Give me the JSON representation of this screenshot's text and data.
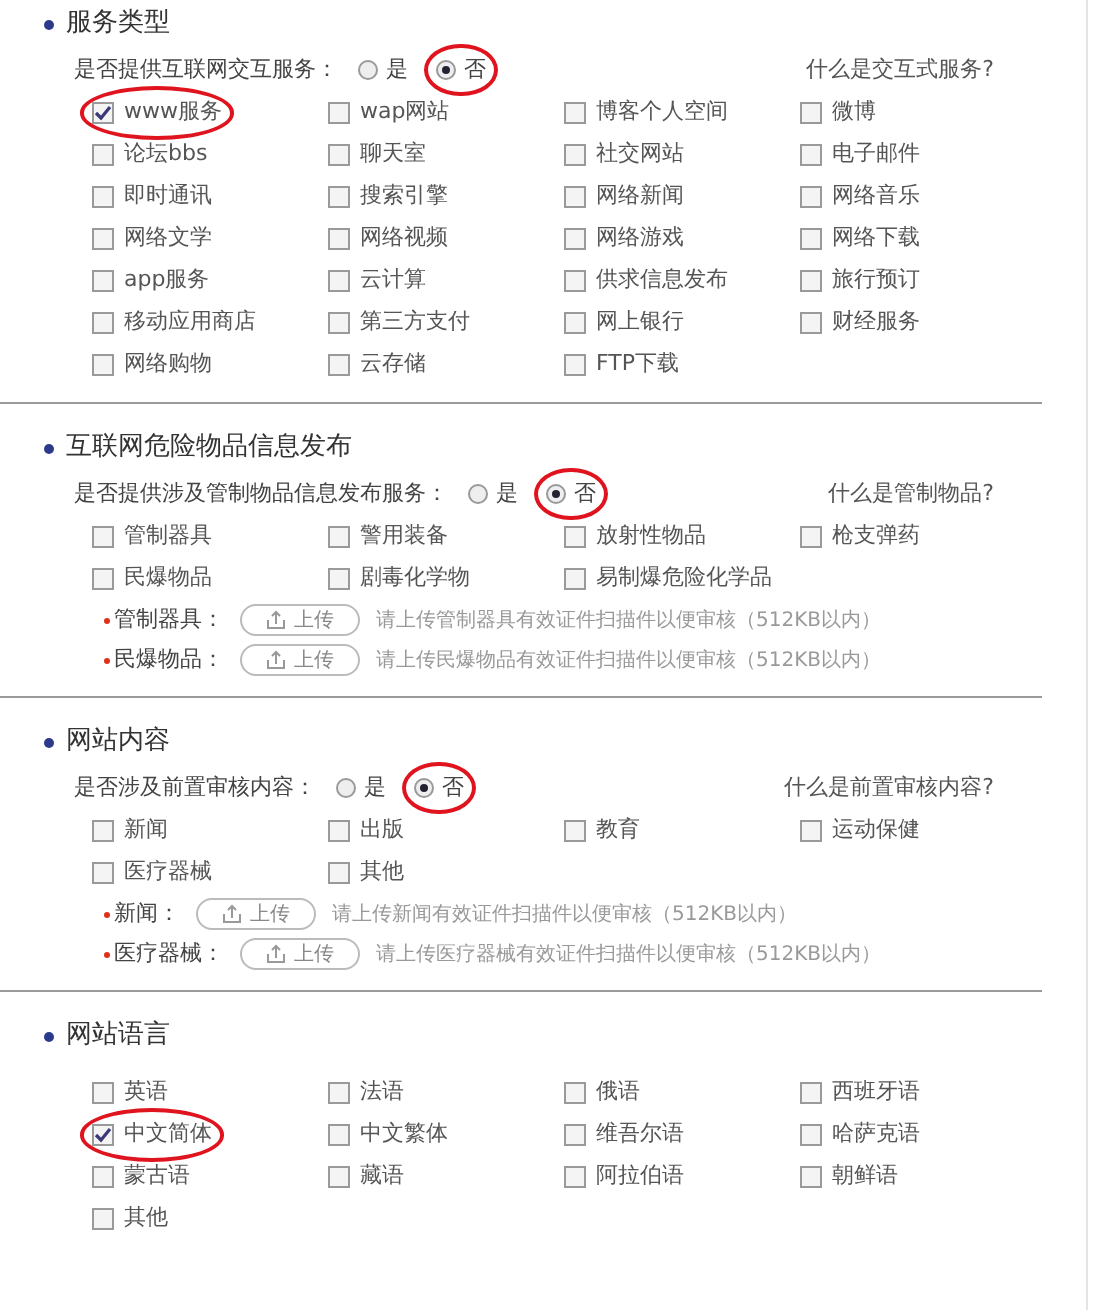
{
  "sections": [
    {
      "title": "服务类型",
      "question": {
        "label": "是否提供互联网交互服务：",
        "options": [
          {
            "label": "是",
            "selected": false,
            "circled": false
          },
          {
            "label": "否",
            "selected": true,
            "circled": true
          }
        ],
        "help_link": "什么是交互式服务?"
      },
      "items": [
        {
          "label": "www服务",
          "checked": true,
          "circled": true
        },
        {
          "label": "wap网站",
          "checked": false,
          "circled": false
        },
        {
          "label": "博客个人空间",
          "checked": false,
          "circled": false
        },
        {
          "label": "微博",
          "checked": false,
          "circled": false
        },
        {
          "label": "论坛bbs",
          "checked": false,
          "circled": false
        },
        {
          "label": "聊天室",
          "checked": false,
          "circled": false
        },
        {
          "label": "社交网站",
          "checked": false,
          "circled": false
        },
        {
          "label": "电子邮件",
          "checked": false,
          "circled": false
        },
        {
          "label": "即时通讯",
          "checked": false,
          "circled": false
        },
        {
          "label": "搜索引擎",
          "checked": false,
          "circled": false
        },
        {
          "label": "网络新闻",
          "checked": false,
          "circled": false
        },
        {
          "label": "网络音乐",
          "checked": false,
          "circled": false
        },
        {
          "label": "网络文学",
          "checked": false,
          "circled": false
        },
        {
          "label": "网络视频",
          "checked": false,
          "circled": false
        },
        {
          "label": "网络游戏",
          "checked": false,
          "circled": false
        },
        {
          "label": "网络下载",
          "checked": false,
          "circled": false
        },
        {
          "label": "app服务",
          "checked": false,
          "circled": false
        },
        {
          "label": "云计算",
          "checked": false,
          "circled": false
        },
        {
          "label": "供求信息发布",
          "checked": false,
          "circled": false
        },
        {
          "label": "旅行预订",
          "checked": false,
          "circled": false
        },
        {
          "label": "移动应用商店",
          "checked": false,
          "circled": false
        },
        {
          "label": "第三方支付",
          "checked": false,
          "circled": false
        },
        {
          "label": "网上银行",
          "checked": false,
          "circled": false
        },
        {
          "label": "财经服务",
          "checked": false,
          "circled": false
        },
        {
          "label": "网络购物",
          "checked": false,
          "circled": false
        },
        {
          "label": "云存储",
          "checked": false,
          "circled": false
        },
        {
          "label": "FTP下载",
          "checked": false,
          "circled": false
        }
      ]
    },
    {
      "title": "互联网危险物品信息发布",
      "question": {
        "label": "是否提供涉及管制物品信息发布服务：",
        "options": [
          {
            "label": "是",
            "selected": false,
            "circled": false
          },
          {
            "label": "否",
            "selected": true,
            "circled": true
          }
        ],
        "help_link": "什么是管制物品?"
      },
      "items": [
        {
          "label": "管制器具",
          "checked": false,
          "circled": false
        },
        {
          "label": "警用装备",
          "checked": false,
          "circled": false
        },
        {
          "label": "放射性物品",
          "checked": false,
          "circled": false
        },
        {
          "label": "枪支弹药",
          "checked": false,
          "circled": false
        },
        {
          "label": "民爆物品",
          "checked": false,
          "circled": false
        },
        {
          "label": "剧毒化学物",
          "checked": false,
          "circled": false
        },
        {
          "label": "易制爆危险化学品",
          "checked": false,
          "circled": false
        }
      ],
      "uploads": [
        {
          "label": "管制器具：",
          "button": "上传",
          "hint": "请上传管制器具有效证件扫描件以便审核（512KB以内）"
        },
        {
          "label": "民爆物品：",
          "button": "上传",
          "hint": "请上传民爆物品有效证件扫描件以便审核（512KB以内）"
        }
      ]
    },
    {
      "title": "网站内容",
      "question": {
        "label": "是否涉及前置审核内容：",
        "options": [
          {
            "label": "是",
            "selected": false,
            "circled": false
          },
          {
            "label": "否",
            "selected": true,
            "circled": true
          }
        ],
        "help_link": "什么是前置审核内容?"
      },
      "items": [
        {
          "label": "新闻",
          "checked": false,
          "circled": false
        },
        {
          "label": "出版",
          "checked": false,
          "circled": false
        },
        {
          "label": "教育",
          "checked": false,
          "circled": false
        },
        {
          "label": "运动保健",
          "checked": false,
          "circled": false
        },
        {
          "label": "医疗器械",
          "checked": false,
          "circled": false
        },
        {
          "label": "其他",
          "checked": false,
          "circled": false
        }
      ],
      "uploads": [
        {
          "label": "新闻：",
          "button": "上传",
          "hint": "请上传新闻有效证件扫描件以便审核（512KB以内）"
        },
        {
          "label": "医疗器械：",
          "button": "上传",
          "hint": "请上传医疗器械有效证件扫描件以便审核（512KB以内）"
        }
      ]
    },
    {
      "title": "网站语言",
      "items": [
        {
          "label": "英语",
          "checked": false,
          "circled": false
        },
        {
          "label": "法语",
          "checked": false,
          "circled": false
        },
        {
          "label": "俄语",
          "checked": false,
          "circled": false
        },
        {
          "label": "西班牙语",
          "checked": false,
          "circled": false
        },
        {
          "label": "中文简体",
          "checked": true,
          "circled": true
        },
        {
          "label": "中文繁体",
          "checked": false,
          "circled": false
        },
        {
          "label": "维吾尔语",
          "checked": false,
          "circled": false
        },
        {
          "label": "哈萨克语",
          "checked": false,
          "circled": false
        },
        {
          "label": "蒙古语",
          "checked": false,
          "circled": false
        },
        {
          "label": "藏语",
          "checked": false,
          "circled": false
        },
        {
          "label": "阿拉伯语",
          "checked": false,
          "circled": false
        },
        {
          "label": "朝鲜语",
          "checked": false,
          "circled": false
        },
        {
          "label": "其他",
          "checked": false,
          "circled": false
        }
      ]
    }
  ]
}
